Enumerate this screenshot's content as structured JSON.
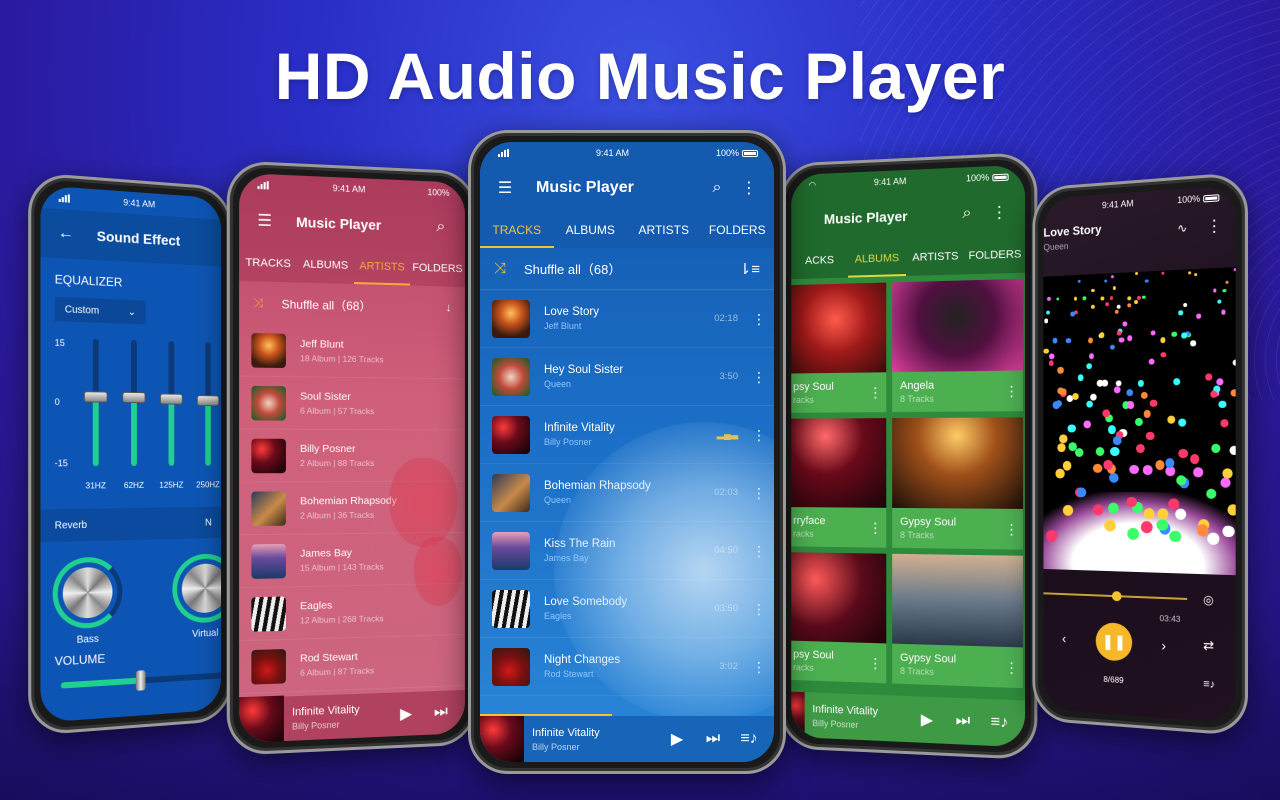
{
  "headline": "HD Audio Music Player",
  "colors": {
    "accent_yellow": "#f4c430",
    "eq_green": "#1fd08f",
    "blue_theme": "#1358ae",
    "pink_theme": "#c9566f",
    "green_theme": "#2e8b3c"
  },
  "status_bar": {
    "time": "9:41 AM",
    "battery": "100%"
  },
  "sound_effect": {
    "title": "Sound Effect",
    "back_icon": "arrow-left-icon",
    "equalizer_label": "EQUALIZER",
    "preset": "Custom",
    "scale": {
      "max": "15",
      "mid": "0",
      "min": "-15"
    },
    "bands": [
      {
        "freq": "31HZ",
        "level": 0.55
      },
      {
        "freq": "62HZ",
        "level": 0.55
      },
      {
        "freq": "125HZ",
        "level": 0.54
      },
      {
        "freq": "250HZ",
        "level": 0.53
      }
    ],
    "reverb_label": "Reverb",
    "reverb_value": "N",
    "knobs": [
      {
        "label": "Bass"
      },
      {
        "label": "Virtual"
      }
    ],
    "volume_label": "VOLUME",
    "volume_level": 0.45
  },
  "artists_screen": {
    "title": "Music Player",
    "tabs": [
      "TRACKS",
      "ALBUMS",
      "ARTISTS",
      "FOLDERS"
    ],
    "active_tab": "ARTISTS",
    "shuffle_label": "Shuffle all（68）",
    "artists": [
      {
        "name": "Jeff Blunt",
        "meta": "18 Album | 126 Tracks"
      },
      {
        "name": "Soul Sister",
        "meta": "6 Album | 57 Tracks"
      },
      {
        "name": "Billy Posner",
        "meta": "2 Album | 88 Tracks"
      },
      {
        "name": "Bohemian Rhapsody",
        "meta": "2 Album | 36 Tracks"
      },
      {
        "name": "James Bay",
        "meta": "15 Album | 143 Tracks"
      },
      {
        "name": "Eagles",
        "meta": "12 Album | 268 Tracks"
      },
      {
        "name": "Rod Stewart",
        "meta": "6 Album | 87 Tracks"
      }
    ],
    "mini_player": {
      "title": "Infinite Vitality",
      "artist": "Billy Posner"
    }
  },
  "tracks_screen": {
    "title": "Music Player",
    "tabs": [
      "TRACKS",
      "ALBUMS",
      "ARTISTS",
      "FOLDERS"
    ],
    "active_tab": "TRACKS",
    "shuffle_label": "Shuffle all（68）",
    "tracks": [
      {
        "title": "Love Story",
        "artist": "Jeff Blunt",
        "duration": "02:18"
      },
      {
        "title": "Hey Soul Sister",
        "artist": "Queen",
        "duration": "3:50"
      },
      {
        "title": "Infinite Vitality",
        "artist": "Billy Posner",
        "duration": "",
        "playing": true
      },
      {
        "title": "Bohemian Rhapsody",
        "artist": "Queen",
        "duration": "02:03"
      },
      {
        "title": "Kiss The Rain",
        "artist": "James Bay",
        "duration": "04:50"
      },
      {
        "title": "Love Somebody",
        "artist": "Eagles",
        "duration": "03:50"
      },
      {
        "title": "Night Changes",
        "artist": "Rod Stewart",
        "duration": "3:02"
      }
    ],
    "mini_player": {
      "title": "Infinite Vitality",
      "artist": "Billy Posner",
      "progress": 0.45
    }
  },
  "albums_screen": {
    "title": "Music Player",
    "tabs": [
      "ACKS",
      "ALBUMS",
      "ARTISTS",
      "FOLDERS"
    ],
    "active_tab": "ALBUMS",
    "albums": [
      {
        "name": "psy Soul",
        "tracks": "racks"
      },
      {
        "name": "Angela",
        "tracks": "8 Tracks"
      },
      {
        "name": "rryface",
        "tracks": "racks"
      },
      {
        "name": "Gypsy Soul",
        "tracks": "8 Tracks"
      },
      {
        "name": "psy Soul",
        "tracks": "racks"
      },
      {
        "name": "Gypsy Soul",
        "tracks": "8 Tracks"
      }
    ],
    "mini_player": {
      "title": "Infinite Vitality",
      "artist": "Billy Posner"
    }
  },
  "now_playing": {
    "title": "Love Story",
    "artist": "Queen",
    "elapsed_fraction": 0.52,
    "total_time": "03:43",
    "queue_position": "8/689"
  }
}
